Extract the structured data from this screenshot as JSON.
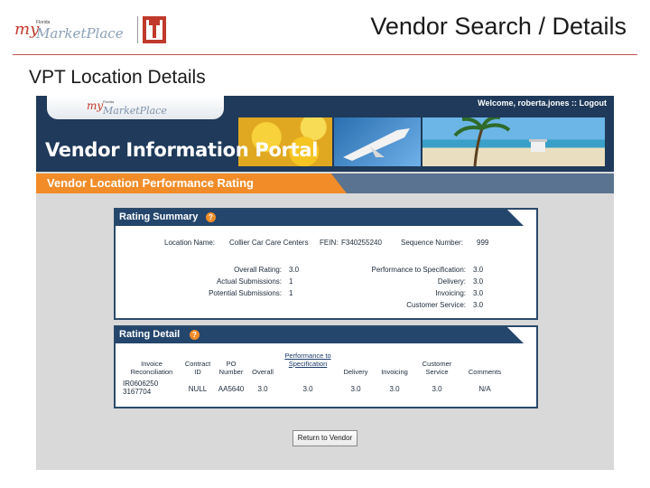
{
  "slide": {
    "logo_text_my": "my",
    "logo_text_florida": "Florida",
    "logo_text_marketplace": "MarketPlace",
    "title": "Vendor Search / Details",
    "subtitle": "VPT Location Details"
  },
  "portal": {
    "logo_text_my": "my",
    "logo_text_florida": "Florida",
    "logo_text_marketplace": "MarketPlace",
    "welcome_text": "Welcome, roberta.jones :: Logout",
    "title": "Vendor Information Portal",
    "section_title": "Vendor Location Performance Rating"
  },
  "rating_summary": {
    "title": "Rating Summary",
    "location_name_label": "Location Name:",
    "location_name_value": "Collier Car Care Centers",
    "fein_label": "FEIN:",
    "fein_value": "F340255240",
    "sequence_label": "Sequence Number:",
    "sequence_value": "999",
    "overall_rating_label": "Overall Rating:",
    "overall_rating_value": "3.0",
    "actual_submissions_label": "Actual Submissions:",
    "actual_submissions_value": "1",
    "potential_submissions_label": "Potential Submissions:",
    "potential_submissions_value": "1",
    "performance_label": "Performance to Specification:",
    "performance_value": "3.0",
    "delivery_label": "Delivery:",
    "delivery_value": "3.0",
    "invoicing_label": "Invoicing:",
    "invoicing_value": "3.0",
    "customer_service_label": "Customer Service:",
    "customer_service_value": "3.0"
  },
  "rating_detail": {
    "title": "Rating Detail",
    "headers": {
      "invoice": "Invoice Reconciliation",
      "contract": "Contract ID",
      "po": "PO Number",
      "overall": "Overall",
      "performance": "Performance to Specification",
      "delivery": "Delivery",
      "invoicing": "Invoicing",
      "customer_service": "Customer Service",
      "comments": "Comments"
    },
    "rows": [
      {
        "invoice": "IR0606250 3167704",
        "contract": "NULL",
        "po": "AA5640",
        "overall": "3.0",
        "performance": "3.0",
        "delivery": "3.0",
        "invoicing": "3.0",
        "customer_service": "3.0",
        "comments": "N/A"
      }
    ]
  },
  "buttons": {
    "return_label": "Return to Vendor"
  },
  "colors": {
    "accent_orange": "#f28c28",
    "portal_navy": "#1f3a5a",
    "slide_rule": "#c0504d"
  }
}
